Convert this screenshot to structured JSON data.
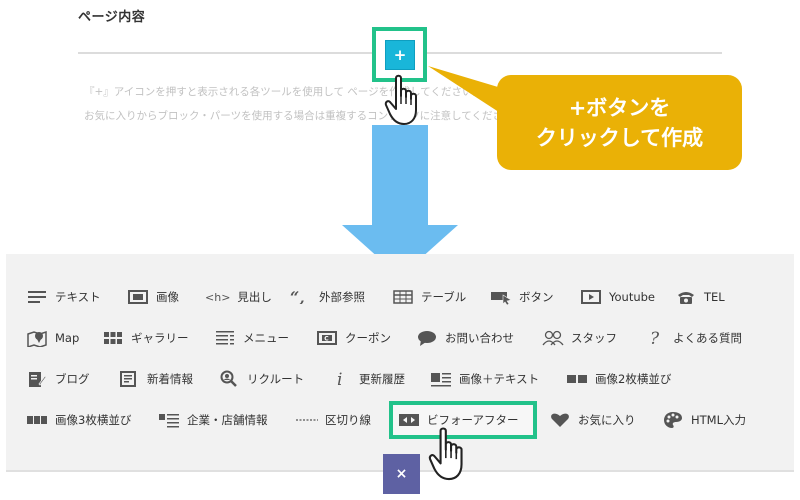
{
  "editor": {
    "title": "ページ内容",
    "add_button_label": "+",
    "description_line1": "『+』アイコンを押すと表示される各ツールを使用して ページを作成してください。",
    "description_line2": "お気に入りからブロック・パーツを使用する場合は重複するコンテンツに注意してください。"
  },
  "callout": {
    "line1": "+ボタンを",
    "line2": "クリックして作成"
  },
  "tools": [
    {
      "label": "テキスト",
      "icon": "text-lines-icon"
    },
    {
      "label": "画像",
      "icon": "image-icon"
    },
    {
      "label": "見出し",
      "icon": "heading-icon",
      "icon_text": "<h>"
    },
    {
      "label": "外部参照",
      "icon": "quote-icon"
    },
    {
      "label": "テーブル",
      "icon": "table-icon"
    },
    {
      "label": "ボタン",
      "icon": "button-cursor-icon"
    },
    {
      "label": "Youtube",
      "icon": "youtube-icon"
    },
    {
      "label": "TEL",
      "icon": "phone-icon"
    },
    {
      "label": "Map",
      "icon": "map-pin-icon"
    },
    {
      "label": "ギャラリー",
      "icon": "gallery-grid-icon"
    },
    {
      "label": "メニュー",
      "icon": "menu-list-icon"
    },
    {
      "label": "クーポン",
      "icon": "coupon-icon"
    },
    {
      "label": "お問い合わせ",
      "icon": "speech-bubble-icon"
    },
    {
      "label": "スタッフ",
      "icon": "staff-icon"
    },
    {
      "label": "よくある質問",
      "icon": "question-icon"
    },
    {
      "label": "ブログ",
      "icon": "blog-pen-icon"
    },
    {
      "label": "新着情報",
      "icon": "news-icon"
    },
    {
      "label": "リクルート",
      "icon": "recruit-search-icon"
    },
    {
      "label": "更新履歴",
      "icon": "info-icon"
    },
    {
      "label": "画像＋テキスト",
      "icon": "image-text-icon"
    },
    {
      "label": "画像2枚横並び",
      "icon": "two-images-icon"
    },
    {
      "label": "画像3枚横並び",
      "icon": "three-images-icon"
    },
    {
      "label": "企業・店舗情報",
      "icon": "company-info-icon"
    },
    {
      "label": "区切り線",
      "icon": "divider-icon"
    },
    {
      "label": "ビフォーアフター",
      "icon": "before-after-icon"
    },
    {
      "label": "お気に入り",
      "icon": "heart-icon"
    },
    {
      "label": "HTML入力",
      "icon": "palette-icon"
    }
  ],
  "close_button_label": "×",
  "colors": {
    "accent_highlight": "#22c28a",
    "add_button": "#19b6d9",
    "callout": "#eab106",
    "arrow": "#6bbcf0",
    "close_button": "#5e61a3",
    "icon": "#555555"
  }
}
